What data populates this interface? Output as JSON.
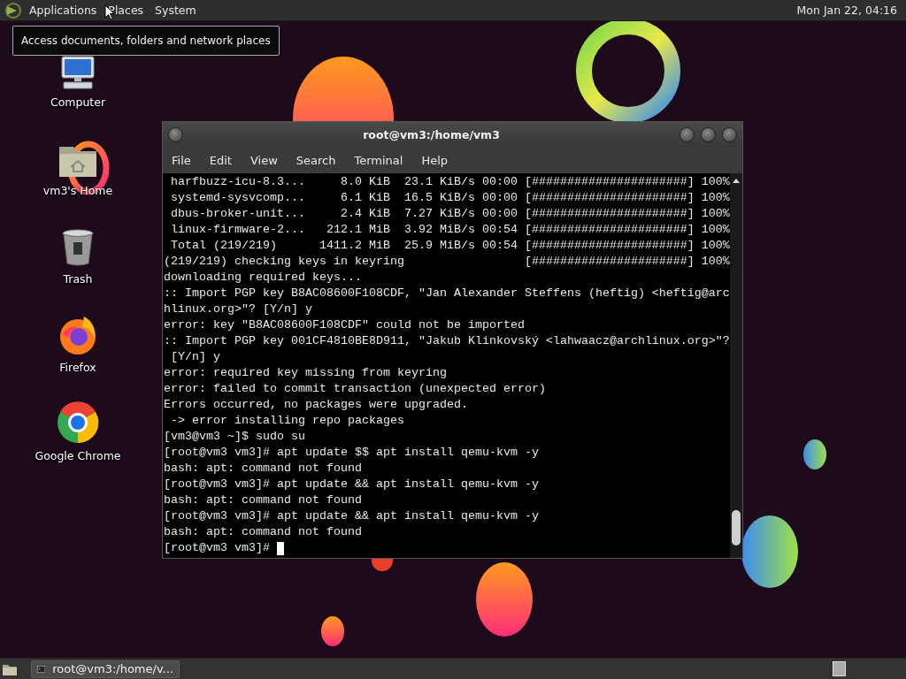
{
  "top_panel": {
    "menus": [
      {
        "label": "Applications"
      },
      {
        "label": "Places"
      },
      {
        "label": "System"
      }
    ],
    "clock": "Mon Jan 22, 04:16"
  },
  "tooltip": {
    "text": "Access documents, folders and network places"
  },
  "desktop_icons": [
    {
      "label": "Computer",
      "kind": "computer"
    },
    {
      "label": "vm3's Home",
      "kind": "home"
    },
    {
      "label": "Trash",
      "kind": "trash"
    },
    {
      "label": "Firefox",
      "kind": "firefox"
    },
    {
      "label": "Google Chrome",
      "kind": "chrome"
    }
  ],
  "terminal": {
    "title": "root@vm3:/home/vm3",
    "menu": [
      "File",
      "Edit",
      "View",
      "Search",
      "Terminal",
      "Help"
    ],
    "lines": [
      " harfbuzz-icu-8.3...     8.0 KiB  23.1 KiB/s 00:00 [######################] 100%",
      " systemd-sysvcomp...     6.1 KiB  16.5 KiB/s 00:00 [######################] 100%",
      " dbus-broker-unit...     2.4 KiB  7.27 KiB/s 00:00 [######################] 100%",
      " linux-firmware-2...   212.1 MiB  3.92 MiB/s 00:54 [######################] 100%",
      " Total (219/219)      1411.2 MiB  25.9 MiB/s 00:54 [######################] 100%",
      "(219/219) checking keys in keyring                 [######################] 100%",
      "downloading required keys...",
      ":: Import PGP key B8AC08600F108CDF, \"Jan Alexander Steffens (heftig) <heftig@arc",
      "hlinux.org>\"? [Y/n] y",
      "error: key \"B8AC08600F108CDF\" could not be imported",
      ":: Import PGP key 001CF4810BE8D911, \"Jakub Klinkovský <lahwaacz@archlinux.org>\"?",
      " [Y/n] y",
      "error: required key missing from keyring",
      "error: failed to commit transaction (unexpected error)",
      "Errors occurred, no packages were upgraded.",
      " -> error installing repo packages",
      "[vm3@vm3 ~]$ sudo su",
      "[root@vm3 vm3]# apt update $$ apt install qemu-kvm -y",
      "bash: apt: command not found",
      "[root@vm3 vm3]# apt update && apt install qemu-kvm -y",
      "bash: apt: command not found",
      "[root@vm3 vm3]# apt update && apt install qemu-kvm -y",
      "bash: apt: command not found",
      "[root@vm3 vm3]# "
    ]
  },
  "taskbar": {
    "tasks": [
      {
        "label": "root@vm3:/home/v..."
      }
    ]
  }
}
